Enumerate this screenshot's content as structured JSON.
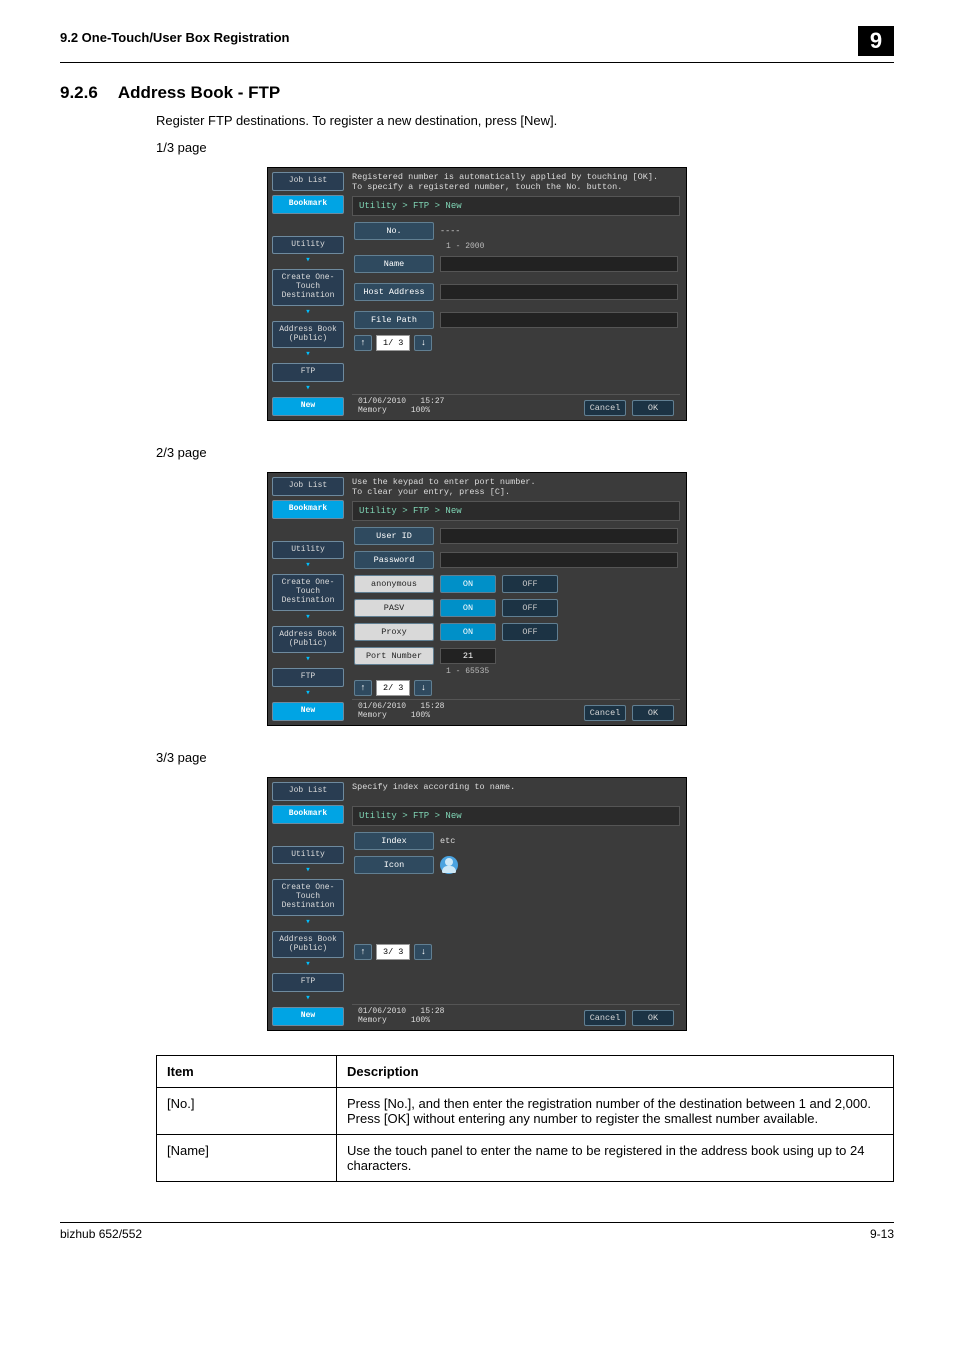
{
  "header": {
    "left": "9.2    One-Touch/User Box Registration",
    "chapter": "9"
  },
  "heading": {
    "num": "9.2.6",
    "title": "Address Book - FTP"
  },
  "intro1": "Register FTP destinations. To register a new destination, press [New].",
  "page_labels": {
    "p1": "1/3 page",
    "p2": "2/3 page",
    "p3": "3/3 page"
  },
  "side_buttons": {
    "job_list": "Job List",
    "bookmark": "Bookmark",
    "utility": "Utility",
    "create": "Create One-Touch\nDestination",
    "address_book": "Address Book\n(Public)",
    "ftp": "FTP",
    "new": "New"
  },
  "panel_common": {
    "breadcrumb": "Utility > FTP > New",
    "cancel": "Cancel",
    "ok": "OK",
    "memory_label": "Memory",
    "memory_value": "100%",
    "date": "01/06/2010"
  },
  "panel1": {
    "hint": "Registered number is automatically applied by touching [OK].\nTo specify a registered number, touch the No. button.",
    "no": "No.",
    "no_value": "----",
    "no_range": "1 - 2000",
    "name": "Name",
    "host_address": "Host Address",
    "file_path": "File Path",
    "pager": "1/ 3",
    "time": "15:27"
  },
  "panel2": {
    "hint": "Use the keypad to enter port number.\nTo clear your entry, press [C].",
    "user_id": "User ID",
    "password": "Password",
    "anonymous": "anonymous",
    "pasv": "PASV",
    "proxy": "Proxy",
    "port_number": "Port Number",
    "port_value": "21",
    "port_range": "1  -  65535",
    "on": "ON",
    "off": "OFF",
    "pager": "2/ 3",
    "time": "15:28"
  },
  "panel3": {
    "hint": "Specify index according to name.",
    "index": "Index",
    "index_value": "etc",
    "icon": "Icon",
    "pager": "3/ 3",
    "time": "15:28"
  },
  "table": {
    "h_item": "Item",
    "h_desc": "Description",
    "rows": [
      {
        "item": "[No.]",
        "desc": "Press [No.], and then enter the registration number of the destination between 1 and 2,000. Press [OK] without entering any number to register the smallest number available."
      },
      {
        "item": "[Name]",
        "desc": "Use the touch panel to enter the name to be registered in the address book using up to 24 characters."
      }
    ]
  },
  "footer": {
    "left": "bizhub 652/552",
    "right": "9-13"
  }
}
